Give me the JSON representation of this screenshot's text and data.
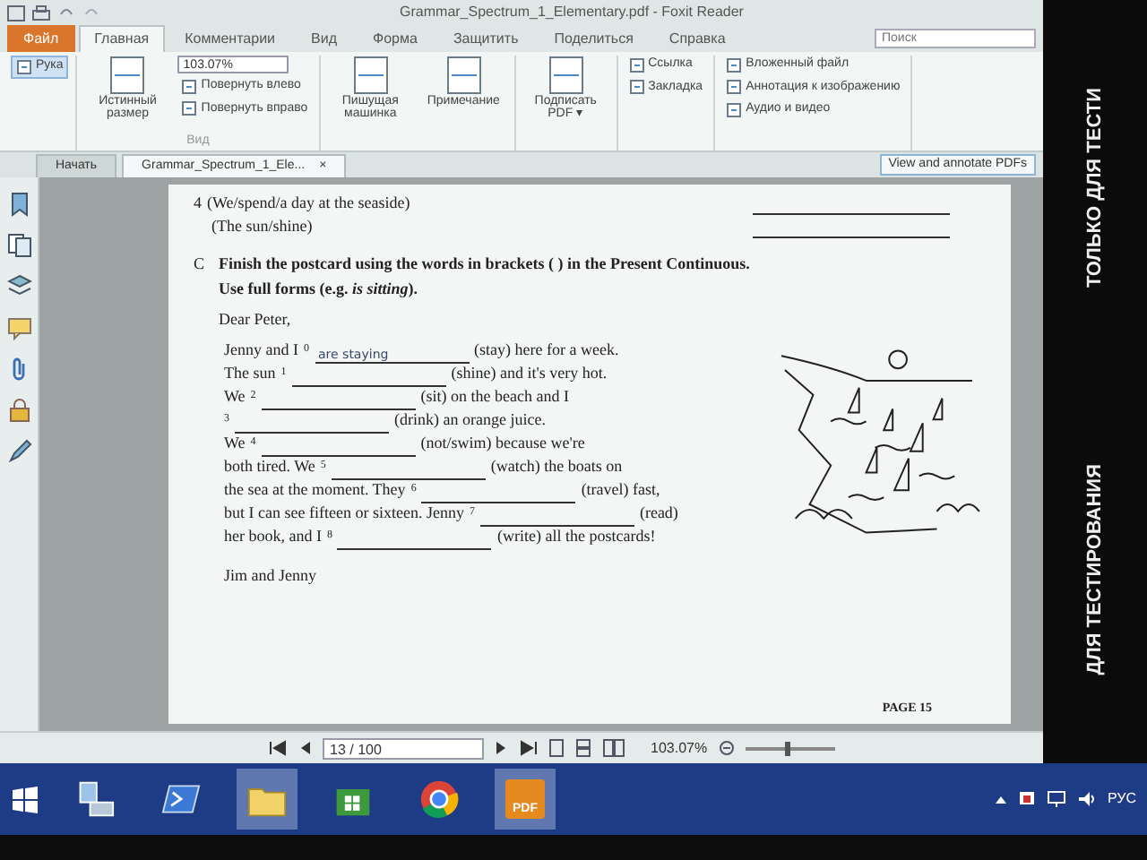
{
  "window": {
    "title": "Grammar_Spectrum_1_Elementary.pdf - Foxit Reader"
  },
  "overlay_texts": [
    "ТОЛЬКО ДЛЯ ТЕСТИ",
    "ДЛЯ ТЕСТИРОВАНИЯ"
  ],
  "ribbon_tabs": [
    {
      "label": "Файл",
      "kind": "file",
      "selected": false
    },
    {
      "label": "Главная",
      "kind": "tab",
      "selected": true
    },
    {
      "label": "Комментарии",
      "kind": "tab",
      "selected": false
    },
    {
      "label": "Вид",
      "kind": "tab",
      "selected": false
    },
    {
      "label": "Форма",
      "kind": "tab",
      "selected": false
    },
    {
      "label": "Защитить",
      "kind": "tab",
      "selected": false
    },
    {
      "label": "Поделиться",
      "kind": "tab",
      "selected": false
    },
    {
      "label": "Справка",
      "kind": "tab",
      "selected": false
    }
  ],
  "search": {
    "placeholder": "Поиск"
  },
  "ribbon_groups": [
    {
      "items": [
        {
          "kind": "tool",
          "label": "Рука",
          "selected": true
        }
      ]
    },
    {
      "label": "Вид",
      "items": [
        {
          "kind": "large",
          "label": "Истинный размер"
        },
        {
          "kind": "zoom",
          "value": "103.07%"
        },
        {
          "kind": "small",
          "label": "Повернуть влево"
        },
        {
          "kind": "small",
          "label": "Повернуть вправо"
        }
      ]
    },
    {
      "items": [
        {
          "kind": "large",
          "label": "Пишущая машинка"
        },
        {
          "kind": "large",
          "label": "Примечание"
        }
      ]
    },
    {
      "items": [
        {
          "kind": "large",
          "label": "Подписать PDF ▾"
        }
      ]
    },
    {
      "items": [
        {
          "kind": "small",
          "label": "Ссылка"
        },
        {
          "kind": "small",
          "label": "Закладка"
        }
      ]
    },
    {
      "items": [
        {
          "kind": "small",
          "label": "Вложенный файл"
        },
        {
          "kind": "small",
          "label": "Аннотация к изображению"
        },
        {
          "kind": "small",
          "label": "Аудио и видео"
        }
      ]
    }
  ],
  "doc_tabs": [
    {
      "label": "Начать",
      "selected": false
    },
    {
      "label": "Grammar_Spectrum_1_Ele...",
      "selected": true,
      "close": "×"
    }
  ],
  "tab_bar_hint": "View and annotate PDFs",
  "page": {
    "previous_items": [
      {
        "number": "4",
        "text": "(We/spend/a day at the seaside)"
      },
      {
        "text": "(The sun/shine)"
      }
    ],
    "exercise": {
      "letter": "C",
      "instruction": "Finish the postcard using the words in brackets ( ) in the Present Continuous.",
      "note": "Use full forms (e.g. *is sitting*)."
    },
    "greeting": "Dear Peter,",
    "lines": [
      {
        "parts": [
          {
            "kind": "text",
            "text": "Jenny and I"
          },
          {
            "kind": "blank",
            "number": "0",
            "answer": "are staying"
          },
          {
            "kind": "text",
            "text": "(stay) here for a week."
          }
        ]
      },
      {
        "parts": [
          {
            "kind": "text",
            "text": "The sun"
          },
          {
            "kind": "blank",
            "number": "1"
          },
          {
            "kind": "text",
            "text": "(shine) and it's very hot."
          }
        ]
      },
      {
        "parts": [
          {
            "kind": "text",
            "text": "We"
          },
          {
            "kind": "blank",
            "number": "2"
          },
          {
            "kind": "text",
            "text": "(sit) on the beach and I"
          }
        ]
      },
      {
        "parts": [
          {
            "kind": "blank",
            "number": "3"
          },
          {
            "kind": "text",
            "text": "(drink) an orange juice."
          }
        ]
      },
      {
        "parts": [
          {
            "kind": "text",
            "text": "We"
          },
          {
            "kind": "blank",
            "number": "4"
          },
          {
            "kind": "text",
            "text": "(not/swim) because we're"
          }
        ]
      },
      {
        "parts": [
          {
            "kind": "text",
            "text": "both tired. We"
          },
          {
            "kind": "blank",
            "number": "5"
          },
          {
            "kind": "text",
            "text": "(watch) the boats on"
          }
        ]
      },
      {
        "parts": [
          {
            "kind": "text",
            "text": "the sea at the moment. They"
          },
          {
            "kind": "blank",
            "number": "6"
          },
          {
            "kind": "text",
            "text": "(travel) fast,"
          }
        ]
      },
      {
        "parts": [
          {
            "kind": "text",
            "text": "but I can see fifteen or sixteen. Jenny"
          },
          {
            "kind": "blank",
            "number": "7"
          },
          {
            "kind": "text",
            "text": "(read)"
          }
        ]
      },
      {
        "parts": [
          {
            "kind": "text",
            "text": "her book, and I"
          },
          {
            "kind": "blank",
            "number": "8"
          },
          {
            "kind": "text",
            "text": "(write) all the postcards!"
          }
        ]
      }
    ],
    "signature": "Jim and Jenny",
    "page_label": "PAGE 15"
  },
  "navigation": {
    "page": "13 / 100",
    "zoom": "103.07%",
    "zoom_slider": {
      "level": 0.45
    }
  },
  "taskbar": {
    "apps": [
      {
        "kind": "server",
        "running": false
      },
      {
        "kind": "terminal",
        "running": false
      },
      {
        "kind": "folder",
        "running": true
      },
      {
        "kind": "store",
        "running": false
      },
      {
        "kind": "browser",
        "running": false
      },
      {
        "kind": "pdf",
        "label": "PDF",
        "running": true
      }
    ],
    "language": "РУС"
  }
}
